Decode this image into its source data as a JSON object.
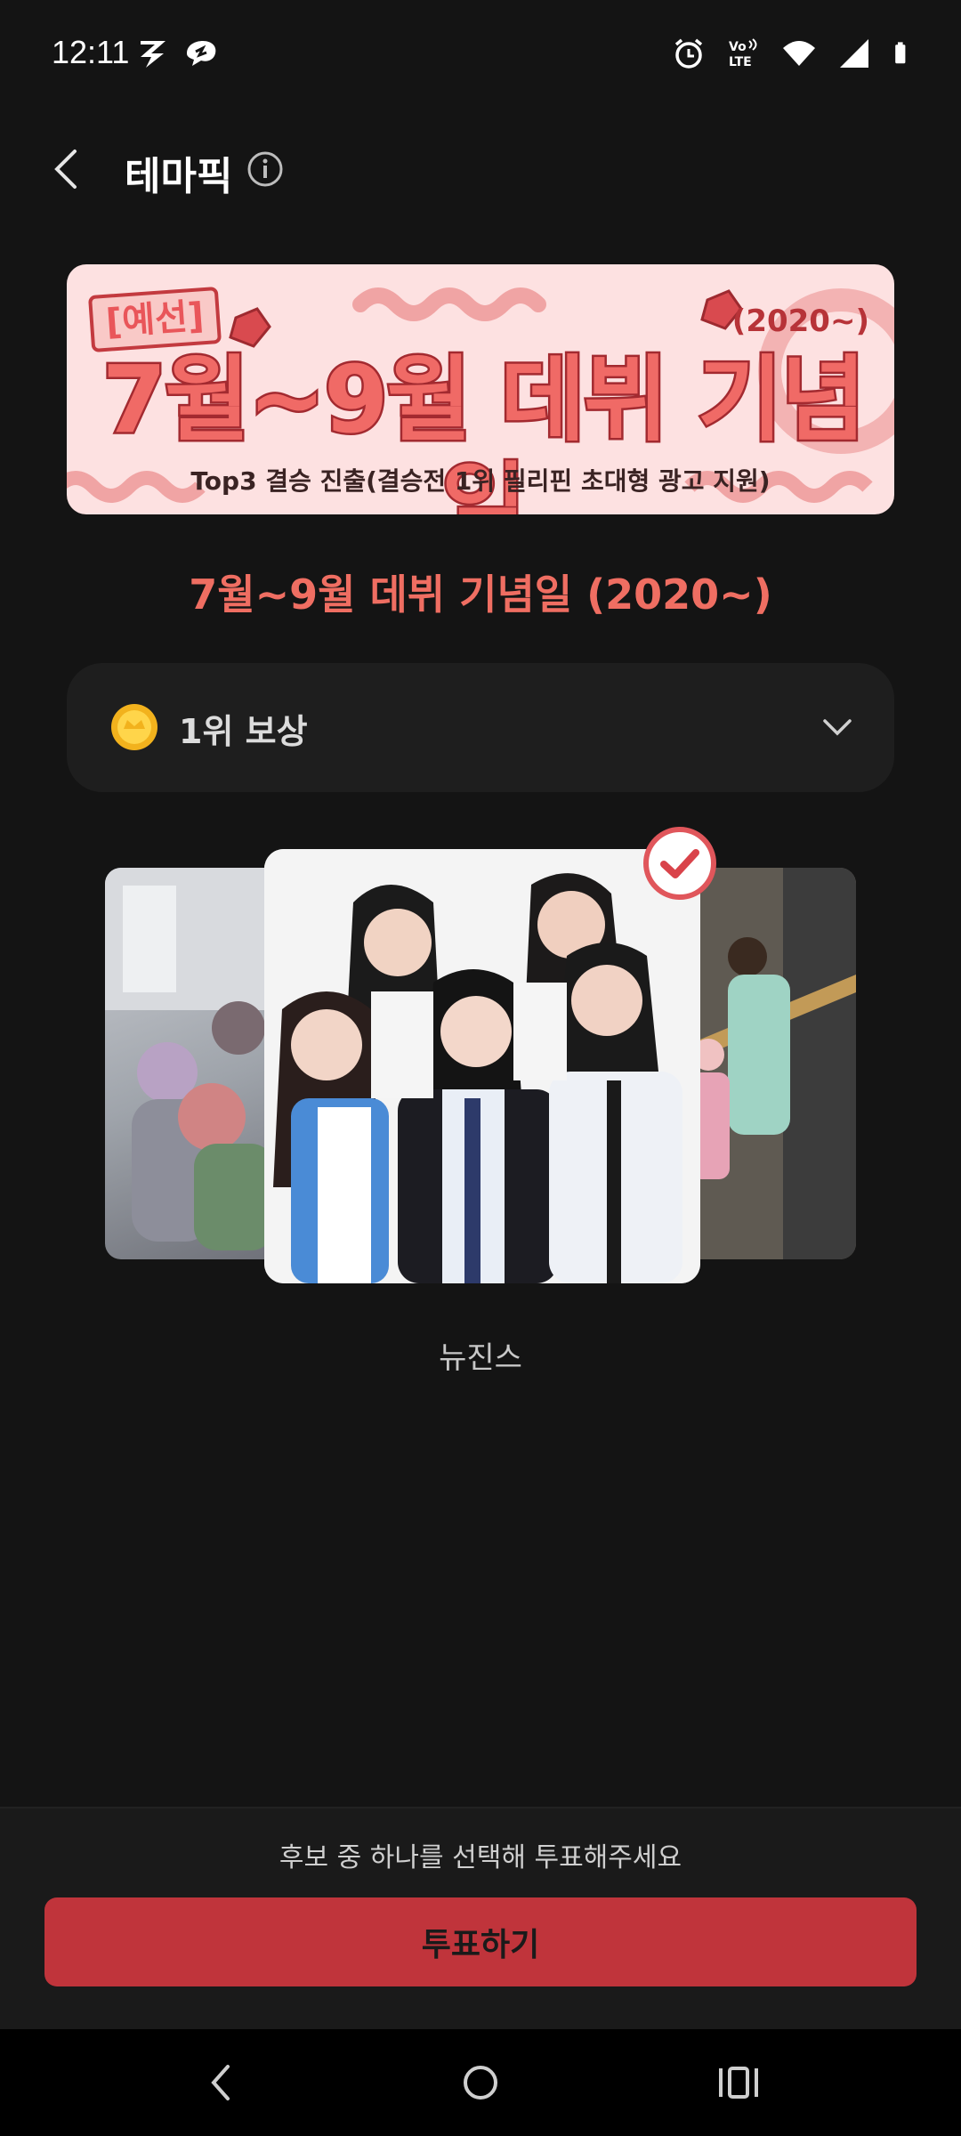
{
  "status_bar": {
    "time": "12:11",
    "left_icons": [
      "z-app-icon",
      "chat-bubble-icon"
    ],
    "right_icons": [
      "alarm-icon",
      "volte-icon",
      "wifi-icon",
      "signal-icon",
      "battery-icon"
    ],
    "volte_text": "Vo LTE"
  },
  "header": {
    "title": "테마픽",
    "back_icon": "chevron-left-icon",
    "info_icon": "info-icon"
  },
  "banner": {
    "tag": "[예선]",
    "year": "(2020~)",
    "headline": "7월~9월 데뷔 기념일",
    "subtitle": "Top3 결승 진출(결승전 1위 필리핀 초대형 광고 지원)"
  },
  "theme_title": "7월~9월 데뷔 기념일 (2020~)",
  "reward": {
    "label": "1위 보상",
    "icon": "coin-icon",
    "expand_icon": "chevron-down-icon"
  },
  "carousel": {
    "selected_candidate": "뉴진스",
    "selected_icon": "check-circle-icon"
  },
  "footer": {
    "hint": "후보 중 하나를 선택해 투표해주세요",
    "vote_button_label": "투표하기"
  },
  "colors": {
    "background": "#141414",
    "accent": "#c0343b",
    "title_accent": "#ef6e62"
  }
}
